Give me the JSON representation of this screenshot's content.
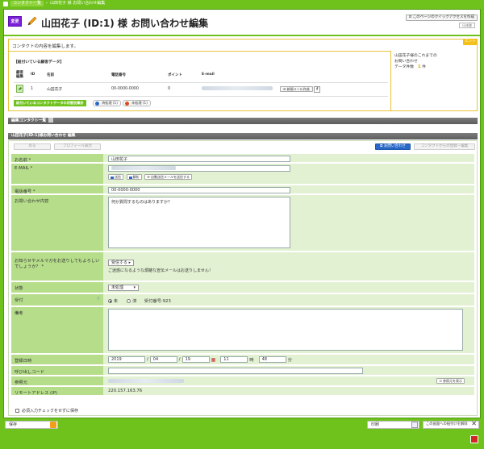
{
  "breadcrumb": {
    "items": [
      "コンタクト一覧",
      "山田花子 様 お問い合わせ編集"
    ]
  },
  "header": {
    "change_badge": "変更",
    "title": "山田花子 (ID:1) 様 お問い合わせ編集",
    "quick_access": "このページのクイックアクセスを作成",
    "spec_btn": "仕様書"
  },
  "contact_box": {
    "hint": "コンタクトの内容を編集します。",
    "hint_tag": "ヒント",
    "linked_label": "【紐付いている顧客データ】",
    "columns": [
      "顧客\n編集",
      "ID",
      "名前",
      "電話番号",
      "ポイント",
      "E-mail"
    ],
    "row": {
      "id": "1",
      "name": "山田花子",
      "phone": "00-0000-0000",
      "points": "0"
    },
    "mail_btn": "新規メール作成",
    "fb": "f",
    "status_strip": "紐付いているコンタクトデータの状態別集計",
    "chip_done": "済処理 (1)",
    "chip_todo": "未処理 (1)",
    "side": {
      "line1": "山田花子様のこれまでの",
      "line2": "お問い合わせ",
      "line3_prefix": "データ件数",
      "count": "1",
      "unit": "件"
    }
  },
  "section_bars": {
    "list": "編集コンタクト一覧",
    "form": "山田花子(ID:1)様お問い合わせ 編集"
  },
  "toolbar": {
    "back": "戻る",
    "profile": "プロフィール表示",
    "inquiry": "お問い合わせ",
    "register": "コンタクトからの登録・編集"
  },
  "form": {
    "name": {
      "label": "お名前 *",
      "value": "山田花子"
    },
    "email": {
      "label": "E-MAIL *",
      "btns": [
        "送信",
        "解析",
        "自動送信メールを送信する"
      ]
    },
    "phone": {
      "label": "電話番号 *",
      "value": "00-0000-0000"
    },
    "inquiry": {
      "label": "お問い合わせ内容",
      "value": "何か質問するものはありますか？"
    },
    "newsletter": {
      "label": "お知らせやメルマガをお送りしてもよろしいでしょうか？ *",
      "value": "受信する",
      "note": "ご迷惑になるような煩雑な宣伝メールはお送りしません！"
    },
    "status": {
      "label": "状態",
      "value": "未処理"
    },
    "reception": {
      "label": "受付",
      "opt1": "未",
      "opt2": "済",
      "number": "受付番号:923"
    },
    "remarks": {
      "label": "備考"
    },
    "datetime": {
      "label": "登録日時",
      "year": "2019",
      "month": "04",
      "day": "19",
      "hour": "11",
      "hour_unit": "時",
      "minute": "48",
      "minute_unit": "分",
      "sep": "/"
    },
    "callcode": {
      "label": "呼び出しコード"
    },
    "referrer": {
      "label": "参照元",
      "btn": "参照元を表示"
    },
    "remote": {
      "label": "リモートアドレス (IP)",
      "value": "220.157.163.76"
    },
    "skip_check": "必須入力チェックをせずに保存"
  },
  "footer": {
    "save": "保存",
    "print": "印刷",
    "cancel": "この画面への紐付けを解除"
  },
  "colors": {
    "frame": "#6fc21c",
    "label_bg": "#b6de8a",
    "value_bg": "#e3f1d3",
    "accent_blue": "#2868c8",
    "badge_purple": "#7c1fd8"
  }
}
